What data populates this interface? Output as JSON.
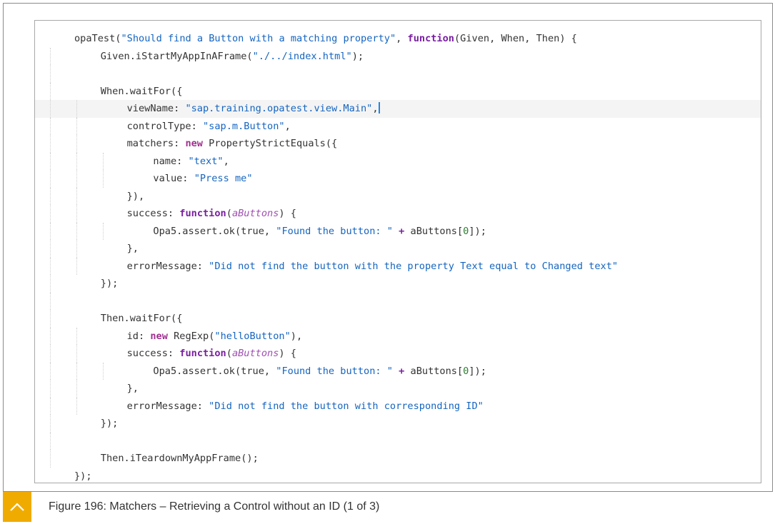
{
  "code_lines": [
    {
      "indent": 0,
      "tokens": [
        {
          "t": "plain",
          "v": "opaTest("
        },
        {
          "t": "str",
          "v": "\"Should find a Button with a matching property\""
        },
        {
          "t": "plain",
          "v": ", "
        },
        {
          "t": "kw",
          "v": "function"
        },
        {
          "t": "plain",
          "v": "(Given, When, Then) {"
        }
      ]
    },
    {
      "indent": 1,
      "tokens": [
        {
          "t": "plain",
          "v": "Given.iStartMyAppInAFrame("
        },
        {
          "t": "str",
          "v": "\"./../index.html\""
        },
        {
          "t": "plain",
          "v": ");"
        }
      ]
    },
    {
      "indent": 1,
      "tokens": []
    },
    {
      "indent": 1,
      "tokens": [
        {
          "t": "plain",
          "v": "When.waitFor({"
        }
      ]
    },
    {
      "indent": 2,
      "highlight": true,
      "cursor": true,
      "tokens": [
        {
          "t": "plain",
          "v": "viewName: "
        },
        {
          "t": "str",
          "v": "\"sap.training.opatest.view.Main\""
        },
        {
          "t": "plain",
          "v": ","
        }
      ]
    },
    {
      "indent": 2,
      "tokens": [
        {
          "t": "plain",
          "v": "controlType: "
        },
        {
          "t": "str",
          "v": "\"sap.m.Button\""
        },
        {
          "t": "plain",
          "v": ","
        }
      ]
    },
    {
      "indent": 2,
      "tokens": [
        {
          "t": "plain",
          "v": "matchers: "
        },
        {
          "t": "kw2",
          "v": "new"
        },
        {
          "t": "plain",
          "v": " PropertyStrictEquals({"
        }
      ]
    },
    {
      "indent": 3,
      "tokens": [
        {
          "t": "plain",
          "v": "name: "
        },
        {
          "t": "str",
          "v": "\"text\""
        },
        {
          "t": "plain",
          "v": ","
        }
      ]
    },
    {
      "indent": 3,
      "tokens": [
        {
          "t": "plain",
          "v": "value: "
        },
        {
          "t": "str",
          "v": "\"Press me\""
        }
      ]
    },
    {
      "indent": 2,
      "tokens": [
        {
          "t": "plain",
          "v": "}),"
        }
      ]
    },
    {
      "indent": 2,
      "tokens": [
        {
          "t": "plain",
          "v": "success: "
        },
        {
          "t": "kw",
          "v": "function"
        },
        {
          "t": "plain",
          "v": "("
        },
        {
          "t": "param",
          "v": "aButtons"
        },
        {
          "t": "plain",
          "v": ") {"
        }
      ]
    },
    {
      "indent": 3,
      "tokens": [
        {
          "t": "plain",
          "v": "Opa5.assert.ok(true, "
        },
        {
          "t": "str",
          "v": "\"Found the button: \""
        },
        {
          "t": "plain",
          "v": " "
        },
        {
          "t": "kw",
          "v": "+"
        },
        {
          "t": "plain",
          "v": " aButtons["
        },
        {
          "t": "num",
          "v": "0"
        },
        {
          "t": "plain",
          "v": "]);"
        }
      ]
    },
    {
      "indent": 2,
      "tokens": [
        {
          "t": "plain",
          "v": "},"
        }
      ]
    },
    {
      "indent": 2,
      "tokens": [
        {
          "t": "plain",
          "v": "errorMessage: "
        },
        {
          "t": "str",
          "v": "\"Did not find the button with the property Text equal to Changed text\""
        }
      ]
    },
    {
      "indent": 1,
      "tokens": [
        {
          "t": "plain",
          "v": "});"
        }
      ]
    },
    {
      "indent": 1,
      "tokens": []
    },
    {
      "indent": 1,
      "tokens": [
        {
          "t": "plain",
          "v": "Then.waitFor({"
        }
      ]
    },
    {
      "indent": 2,
      "tokens": [
        {
          "t": "plain",
          "v": "id: "
        },
        {
          "t": "kw2",
          "v": "new"
        },
        {
          "t": "plain",
          "v": " RegExp("
        },
        {
          "t": "str",
          "v": "\"helloButton\""
        },
        {
          "t": "plain",
          "v": "),"
        }
      ]
    },
    {
      "indent": 2,
      "tokens": [
        {
          "t": "plain",
          "v": "success: "
        },
        {
          "t": "kw",
          "v": "function"
        },
        {
          "t": "plain",
          "v": "("
        },
        {
          "t": "param",
          "v": "aButtons"
        },
        {
          "t": "plain",
          "v": ") {"
        }
      ]
    },
    {
      "indent": 3,
      "tokens": [
        {
          "t": "plain",
          "v": "Opa5.assert.ok(true, "
        },
        {
          "t": "str",
          "v": "\"Found the button: \""
        },
        {
          "t": "plain",
          "v": " "
        },
        {
          "t": "kw",
          "v": "+"
        },
        {
          "t": "plain",
          "v": " aButtons["
        },
        {
          "t": "num",
          "v": "0"
        },
        {
          "t": "plain",
          "v": "]);"
        }
      ]
    },
    {
      "indent": 2,
      "tokens": [
        {
          "t": "plain",
          "v": "},"
        }
      ]
    },
    {
      "indent": 2,
      "tokens": [
        {
          "t": "plain",
          "v": "errorMessage: "
        },
        {
          "t": "str",
          "v": "\"Did not find the button with corresponding ID\""
        }
      ]
    },
    {
      "indent": 1,
      "tokens": [
        {
          "t": "plain",
          "v": "});"
        }
      ]
    },
    {
      "indent": 1,
      "tokens": []
    },
    {
      "indent": 1,
      "tokens": [
        {
          "t": "plain",
          "v": "Then.iTeardownMyAppFrame();"
        }
      ]
    },
    {
      "indent": 0,
      "tokens": [
        {
          "t": "plain",
          "v": "});"
        }
      ]
    }
  ],
  "caption": {
    "text": "Figure 196: Matchers – Retrieving a Control without an ID (1 of 3)",
    "toggle_icon": "chevron-up-icon"
  },
  "colors": {
    "accent": "#f0ab00",
    "keyword": "#7a1fa2",
    "string": "#1565c0",
    "number": "#2e7d32"
  }
}
